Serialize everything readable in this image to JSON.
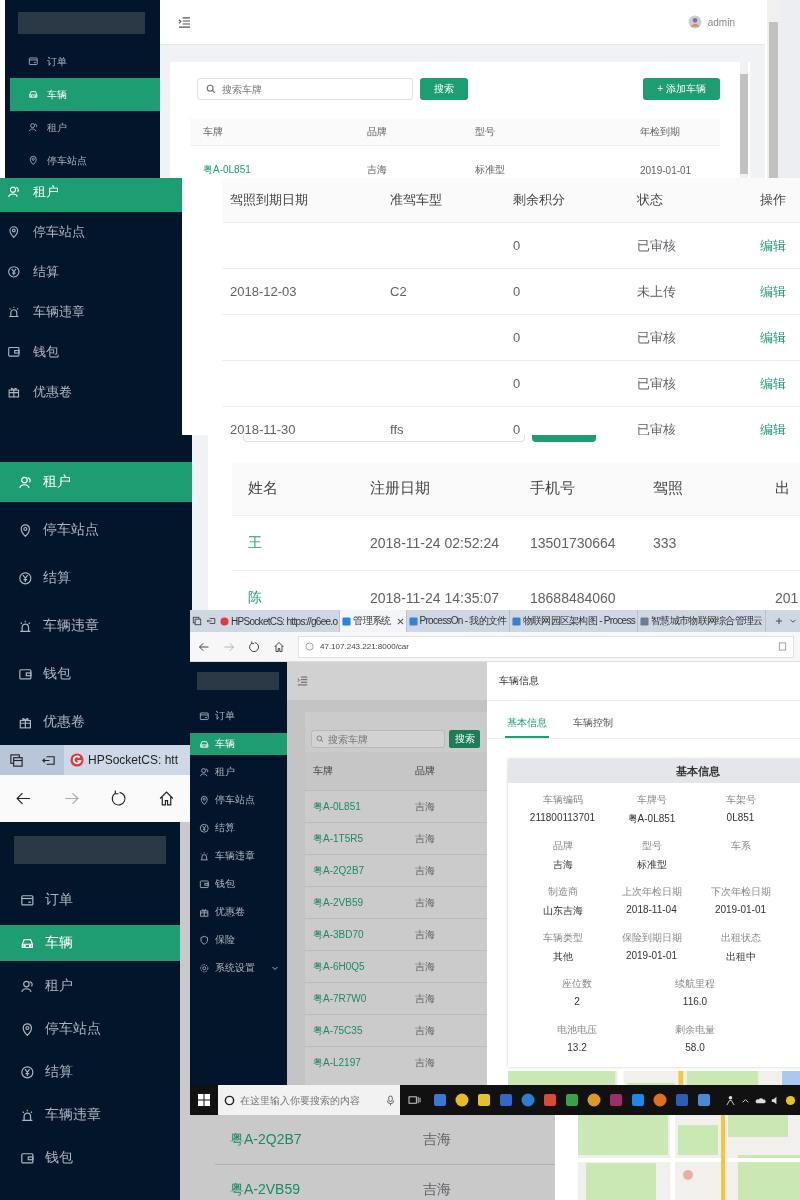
{
  "vehicle_page": {
    "sidebar": [
      {
        "label": "订单",
        "selected": false
      },
      {
        "label": "车辆",
        "selected": true
      },
      {
        "label": "租户",
        "selected": false
      },
      {
        "label": "停车站点",
        "selected": false
      }
    ],
    "user": "admin",
    "search": {
      "placeholder": "搜索车牌"
    },
    "search_button": "搜索",
    "add_button": "+ 添加车辆",
    "table": {
      "columns": [
        "车牌",
        "品牌",
        "型号",
        "年检到期"
      ],
      "rows": [
        {
          "plate": "粤A-0L851",
          "brand": "吉海",
          "model": "标准型",
          "inspection_due": "2019-01-01"
        }
      ]
    }
  },
  "license_page": {
    "sidebar": [
      {
        "label": "租户",
        "selected": true
      },
      {
        "label": "停车站点",
        "selected": false
      },
      {
        "label": "结算",
        "selected": false
      },
      {
        "label": "车辆违章",
        "selected": false
      },
      {
        "label": "钱包",
        "selected": false
      },
      {
        "label": "优惠卷",
        "selected": false
      }
    ],
    "table": {
      "columns": [
        "驾照到期日期",
        "准驾车型",
        "剩余积分",
        "状态",
        "操作"
      ],
      "rows": [
        {
          "points": "0",
          "status": "已审核",
          "action": "编辑"
        },
        {
          "license_expiry": "2018-12-03",
          "license_class": "C2",
          "points": "0",
          "status": "未上传",
          "action": "编辑"
        },
        {
          "points": "0",
          "status": "已审核",
          "action": "编辑"
        },
        {
          "points": "0",
          "status": "已审核",
          "action": "编辑"
        },
        {
          "license_expiry": "2018-11-30",
          "license_class": "ffs",
          "points": "0",
          "status": "已审核",
          "action": "编辑"
        }
      ]
    }
  },
  "tenant_page": {
    "sidebar": [
      {
        "label": "租户",
        "selected": true
      },
      {
        "label": "停车站点",
        "selected": false
      },
      {
        "label": "结算",
        "selected": false
      },
      {
        "label": "车辆违章",
        "selected": false
      },
      {
        "label": "钱包",
        "selected": false
      },
      {
        "label": "优惠卷",
        "selected": false
      }
    ],
    "table": {
      "columns": [
        "姓名",
        "注册日期",
        "手机号",
        "驾照",
        "出"
      ],
      "rows": [
        {
          "name": "王",
          "registered": "2018-11-24 02:52:24",
          "phone": "13501730664",
          "license": "333"
        },
        {
          "name": "陈",
          "registered": "2018-11-24 14:35:07",
          "phone": "18688484060",
          "column_5": "201"
        }
      ]
    }
  },
  "browser_fragment": {
    "tab": "HPSocketCS: htt",
    "sidebar": [
      {
        "label": "订单",
        "selected": false
      },
      {
        "label": "车辆",
        "selected": true
      },
      {
        "label": "租户",
        "selected": false
      },
      {
        "label": "停车站点",
        "selected": false
      },
      {
        "label": "结算",
        "selected": false
      },
      {
        "label": "车辆违章",
        "selected": false
      },
      {
        "label": "钱包",
        "selected": false
      }
    ],
    "table": {
      "rows": [
        {
          "plate": "粤A-2Q2B7",
          "brand": "吉海"
        },
        {
          "plate": "粤A-2VB59",
          "brand": "吉海"
        }
      ]
    }
  },
  "browser": {
    "tabs": [
      {
        "title": "HPSocketCS: https://g6ee.o",
        "selected": false
      },
      {
        "title": "管理系统",
        "selected": true
      },
      {
        "title": "ProcessOn - 我的文件",
        "selected": false
      },
      {
        "title": "物联网园区架构图 - Process",
        "selected": false
      },
      {
        "title": "智慧城市物联网综合管理云",
        "selected": false
      }
    ],
    "address": "47.107.243.221:8000/car",
    "sidebar": [
      {
        "label": "订单",
        "selected": false,
        "submenu": false
      },
      {
        "label": "车辆",
        "selected": true,
        "submenu": false
      },
      {
        "label": "租户",
        "selected": false,
        "submenu": false
      },
      {
        "label": "停车站点",
        "selected": false,
        "submenu": false
      },
      {
        "label": "结算",
        "selected": false,
        "submenu": false
      },
      {
        "label": "车辆违章",
        "selected": false,
        "submenu": false
      },
      {
        "label": "钱包",
        "selected": false,
        "submenu": false
      },
      {
        "label": "优惠卷",
        "selected": false,
        "submenu": false
      },
      {
        "label": "保险",
        "selected": false,
        "submenu": false
      },
      {
        "label": "系统设置",
        "selected": false,
        "submenu": true
      }
    ],
    "search": {
      "placeholder": "搜索车牌"
    },
    "search_button": "搜索",
    "table": {
      "columns": [
        "车牌",
        "品牌"
      ],
      "rows": [
        {
          "plate": "粤A-0L851",
          "brand": "吉海"
        },
        {
          "plate": "粤A-1T5R5",
          "brand": "吉海"
        },
        {
          "plate": "粤A-2Q2B7",
          "brand": "吉海"
        },
        {
          "plate": "粤A-2VB59",
          "brand": "吉海"
        },
        {
          "plate": "粤A-3BD70",
          "brand": "吉海"
        },
        {
          "plate": "粤A-6H0Q5",
          "brand": "吉海"
        },
        {
          "plate": "粤A-7R7W0",
          "brand": "吉海"
        },
        {
          "plate": "粤A-75C35",
          "brand": "吉海"
        },
        {
          "plate": "粤A-L2197",
          "brand": "吉海"
        }
      ]
    },
    "drawer": {
      "title": "车辆信息",
      "tabs": [
        {
          "label": "基本信息",
          "selected": true
        },
        {
          "label": "车辆控制",
          "selected": false
        }
      ],
      "card_title": "基本信息",
      "fields": [
        {
          "label": "车辆编码",
          "value": "211800113701"
        },
        {
          "label": "车牌号",
          "value": "粤A-0L851"
        },
        {
          "label": "车架号",
          "value": "0L851"
        },
        {
          "label": "品牌",
          "value": "吉海"
        },
        {
          "label": "型号",
          "value": "标准型"
        },
        {
          "label": "车系"
        },
        {
          "label": "制造商",
          "value": "山东吉海"
        },
        {
          "label": "上次年检日期",
          "value": "2018-11-04"
        },
        {
          "label": "下次年检日期",
          "value": "2019-01-01"
        },
        {
          "label": "车辆类型",
          "value": "其他"
        },
        {
          "label": "保险到期日期",
          "value": "2019-01-01"
        },
        {
          "label": "出租状态",
          "value": "出租中"
        }
      ],
      "readings": [
        {
          "label": "座位数",
          "value": "2"
        },
        {
          "label": "续航里程",
          "value": "116.0"
        },
        {
          "label": "电池电压",
          "value": "13.2"
        },
        {
          "label": "剩余电量",
          "value": "58.0"
        }
      ]
    },
    "taskbar": {
      "search": {
        "placeholder": "在这里输入你要搜索的内容"
      }
    }
  }
}
